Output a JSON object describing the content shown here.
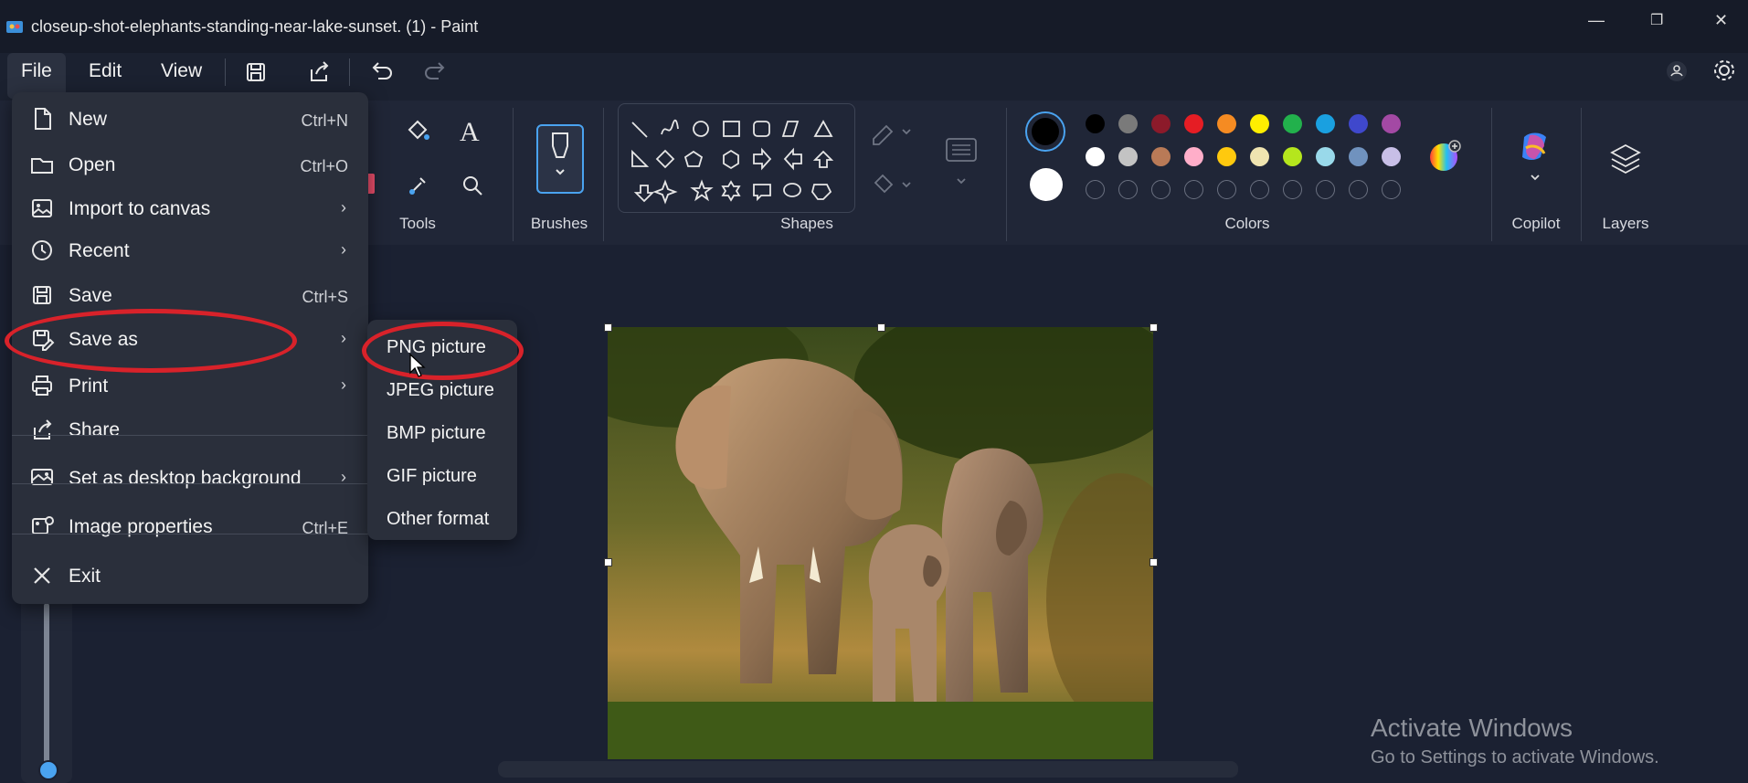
{
  "window": {
    "title": "closeup-shot-elephants-standing-near-lake-sunset. (1) - Paint",
    "minimize": "—",
    "maximize": "❐",
    "close": "✕"
  },
  "menubar": {
    "file": "File",
    "edit": "Edit",
    "view": "View"
  },
  "ribbon": {
    "tools_label": "Tools",
    "brushes_label": "Brushes",
    "shapes_label": "Shapes",
    "colors_label": "Colors",
    "copilot_label": "Copilot",
    "layers_label": "Layers",
    "palette_row1": [
      "#000000",
      "#7a7a7a",
      "#8c1a2a",
      "#e51d24",
      "#f58b22",
      "#ffee00",
      "#22b14c",
      "#1aa0e0",
      "#3f48cc",
      "#a349a4"
    ],
    "palette_row2": [
      "#ffffff",
      "#c3c3c3",
      "#b97a57",
      "#ffaec9",
      "#ffc90e",
      "#efe4b0",
      "#b5e61d",
      "#99d9ea",
      "#7092be",
      "#c8bfe7"
    ]
  },
  "file_menu": {
    "items": [
      {
        "label": "New",
        "shortcut": "Ctrl+N",
        "icon": "new-file-icon"
      },
      {
        "label": "Open",
        "shortcut": "Ctrl+O",
        "icon": "folder-icon"
      },
      {
        "label": "Import to canvas",
        "shortcut": "",
        "icon": "import-image-icon"
      },
      {
        "label": "Recent",
        "shortcut": "",
        "icon": "clock-icon"
      },
      {
        "label": "Save",
        "shortcut": "Ctrl+S",
        "icon": "save-icon"
      },
      {
        "label": "Save as",
        "shortcut": "",
        "icon": "save-as-icon"
      },
      {
        "label": "Print",
        "shortcut": "",
        "icon": "printer-icon"
      },
      {
        "label": "Share",
        "shortcut": "",
        "icon": "share-icon"
      },
      {
        "label": "Set as desktop background",
        "shortcut": "",
        "icon": "desktop-background-icon"
      },
      {
        "label": "Image properties",
        "shortcut": "Ctrl+E",
        "icon": "image-properties-icon"
      },
      {
        "label": "Exit",
        "shortcut": "",
        "icon": "close-icon"
      }
    ]
  },
  "save_as_submenu": {
    "items": [
      "PNG picture",
      "JPEG picture",
      "BMP picture",
      "GIF picture",
      "Other format"
    ]
  },
  "watermark": {
    "title": "Activate Windows",
    "subtitle": "Go to Settings to activate Windows."
  },
  "colors": {
    "highlight_oval": "#d8222a",
    "accent": "#4aa3f0"
  }
}
